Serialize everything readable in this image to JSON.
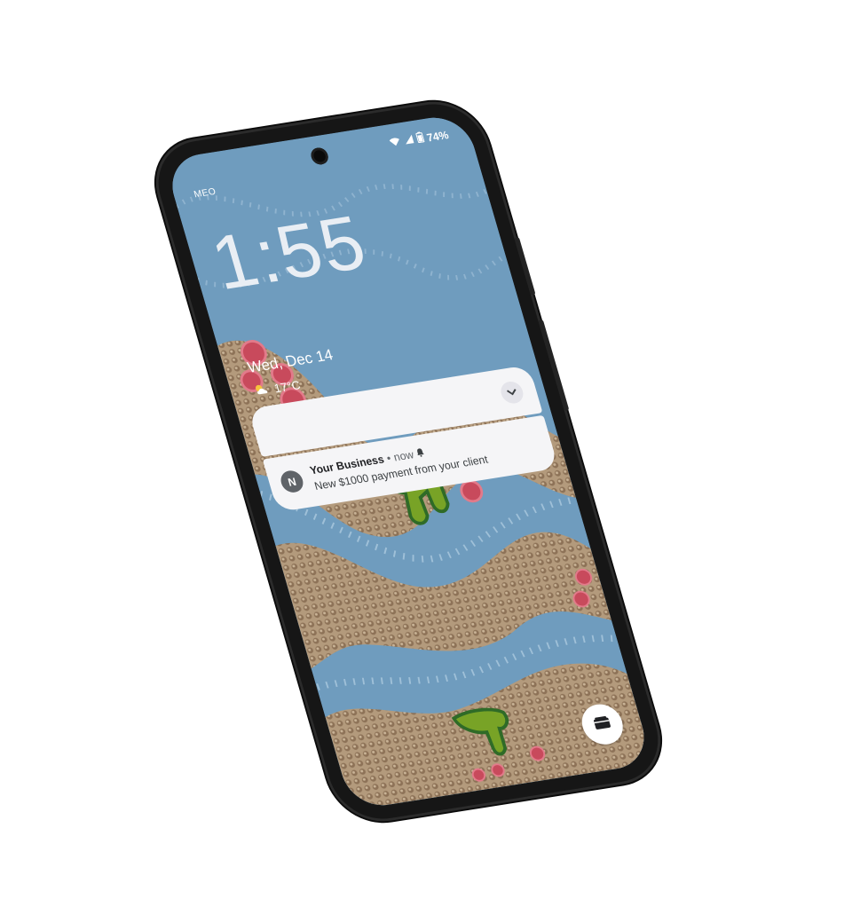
{
  "status_bar": {
    "carrier": "MEO",
    "battery": "74%",
    "icons": [
      "wifi-icon",
      "signal-icon",
      "battery-icon"
    ]
  },
  "lock_screen": {
    "time": "1:55",
    "date": "Wed, Dec 14",
    "temperature": "17°C",
    "weather_icon": "partly-cloudy-icon"
  },
  "notification": {
    "app_initial": "N",
    "app_name": "Your Business",
    "separator": "•",
    "time": "now",
    "body": "New $1000 payment from your client",
    "icons": [
      "bell-icon",
      "chevron-down-icon"
    ]
  },
  "shortcuts": {
    "wallet_icon": "wallet-icon"
  },
  "colors": {
    "wallpaper_water": "#6f9cbe",
    "wallpaper_sand": "#b39a7c",
    "notification_bg": "#f5f5f7",
    "phone_frame": "#161616"
  }
}
